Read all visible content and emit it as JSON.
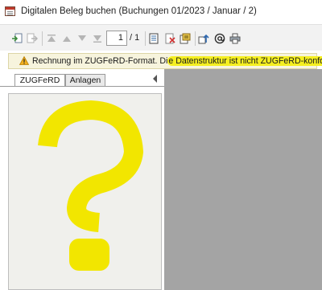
{
  "window": {
    "title": "Digitalen Beleg buchen (Buchungen 01/2023 / Januar / 2)"
  },
  "toolbar": {
    "page_current": "1",
    "page_total": "/ 1",
    "buttons": [
      "import-icon",
      "export-icon",
      "first-page-icon",
      "previous-page-icon",
      "next-page-icon",
      "last-page-icon",
      "document-icon",
      "delete-icon",
      "properties-icon",
      "upload-icon",
      "email-icon",
      "print-icon"
    ]
  },
  "infobar": {
    "icon": "warning-icon",
    "text_before": "Rechnung im ZUGFeRD-Format. Di",
    "text_highlighted": "e Datenstruktur ist nicht ZUGFeRD-konform",
    "text_after": "."
  },
  "tabs": [
    {
      "label": "ZUGFeRD",
      "active": true
    },
    {
      "label": "Anlagen",
      "active": false
    }
  ],
  "colors": {
    "highlight": "#f5ef20",
    "question_mark": "#f2e600",
    "viewer_background": "#a4a4a4",
    "infobar_background": "#f7f4dd"
  },
  "document_preview": {
    "icon": "question-mark-icon"
  }
}
